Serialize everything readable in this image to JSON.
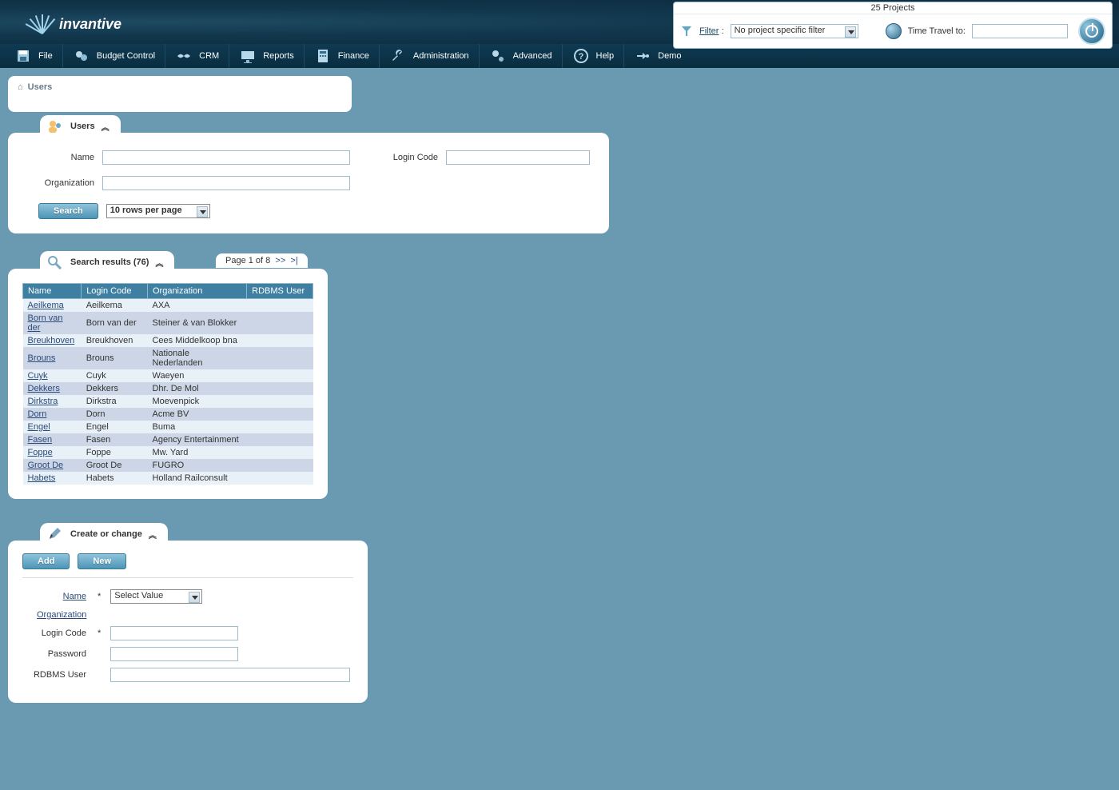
{
  "header": {
    "logo_text": "invantive",
    "projects_count": "25 Projects",
    "filter_label": "Filter",
    "filter_colon": " : ",
    "filter_value": "No project specific filter",
    "time_travel_label": "Time Travel to:",
    "time_travel_value": ""
  },
  "menu": [
    {
      "label": "File",
      "icon": "save-icon"
    },
    {
      "label": "Budget Control",
      "icon": "budget-icon"
    },
    {
      "label": "CRM",
      "icon": "handshake-icon"
    },
    {
      "label": "Reports",
      "icon": "chart-icon"
    },
    {
      "label": "Finance",
      "icon": "calculator-icon"
    },
    {
      "label": "Administration",
      "icon": "wrench-icon"
    },
    {
      "label": "Advanced",
      "icon": "gears-icon"
    },
    {
      "label": "Help",
      "icon": "help-icon"
    },
    {
      "label": "Demo",
      "icon": "demo-icon"
    }
  ],
  "breadcrumb": {
    "title": "Users"
  },
  "search_panel": {
    "tab_title": "Users",
    "labels": {
      "name": "Name",
      "login_code": "Login Code",
      "organization": "Organization"
    },
    "values": {
      "name": "",
      "login_code": "",
      "organization": ""
    },
    "search_button": "Search",
    "rows_per_page": "10 rows per page"
  },
  "results_panel": {
    "tab_title": "Search results (76)",
    "pager": "Page 1 of 8",
    "pager_next": ">>",
    "pager_last": ">|",
    "columns": [
      "Name",
      "Login Code",
      "Organization",
      "RDBMS User"
    ],
    "rows": [
      {
        "name": "Aeilkema",
        "login": "Aeilkema",
        "org": "AXA",
        "rdbms": ""
      },
      {
        "name": "Born van der",
        "login": "Born van der",
        "org": "Steiner & van Blokker",
        "rdbms": ""
      },
      {
        "name": "Breukhoven",
        "login": "Breukhoven",
        "org": "Cees Middelkoop bna",
        "rdbms": ""
      },
      {
        "name": "Brouns",
        "login": "Brouns",
        "org": "Nationale Nederlanden",
        "rdbms": ""
      },
      {
        "name": "Cuyk",
        "login": "Cuyk",
        "org": "Waeyen",
        "rdbms": ""
      },
      {
        "name": "Dekkers",
        "login": "Dekkers",
        "org": "Dhr. De Mol",
        "rdbms": ""
      },
      {
        "name": "Dirkstra",
        "login": "Dirkstra",
        "org": "Moevenpick",
        "rdbms": ""
      },
      {
        "name": "Dorn",
        "login": "Dorn",
        "org": "Acme BV",
        "rdbms": ""
      },
      {
        "name": "Engel",
        "login": "Engel",
        "org": "Buma",
        "rdbms": ""
      },
      {
        "name": "Fasen",
        "login": "Fasen",
        "org": "Agency Entertainment",
        "rdbms": ""
      },
      {
        "name": "Foppe",
        "login": "Foppe",
        "org": "Mw. Yard",
        "rdbms": ""
      },
      {
        "name": "Groot De",
        "login": "Groot De",
        "org": "FUGRO",
        "rdbms": ""
      },
      {
        "name": "Habets",
        "login": "Habets",
        "org": "Holland Railconsult",
        "rdbms": ""
      }
    ]
  },
  "create_panel": {
    "tab_title": "Create or change",
    "buttons": {
      "add": "Add",
      "new": "New"
    },
    "labels": {
      "name": "Name",
      "organization": "Organization",
      "login_code": "Login Code",
      "password": "Password",
      "rdbms_user": "RDBMS User"
    },
    "name_select": "Select Value",
    "values": {
      "login_code": "",
      "password": "",
      "rdbms_user": ""
    }
  }
}
